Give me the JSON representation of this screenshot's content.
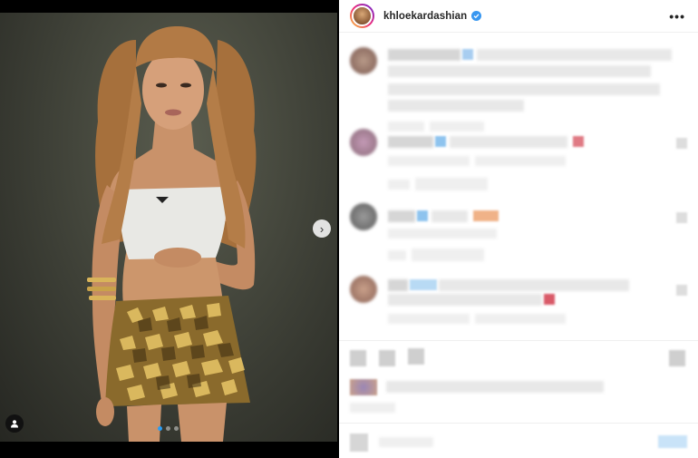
{
  "post": {
    "username": "khloekardashian",
    "verified": true,
    "more_label": "•••",
    "next_label": "›",
    "carousel": {
      "count": 3,
      "active_index": 0
    }
  },
  "colors": {
    "verified_blue": "#3897f0",
    "active_dot": "#2a9df4",
    "story_ring": [
      "#f9ce34",
      "#ee2a7b",
      "#6228d7"
    ]
  },
  "icons": {
    "next": "chevron-right-icon",
    "tag": "user-tag-icon",
    "more": "more-options-icon",
    "verified": "verified-badge-icon"
  }
}
